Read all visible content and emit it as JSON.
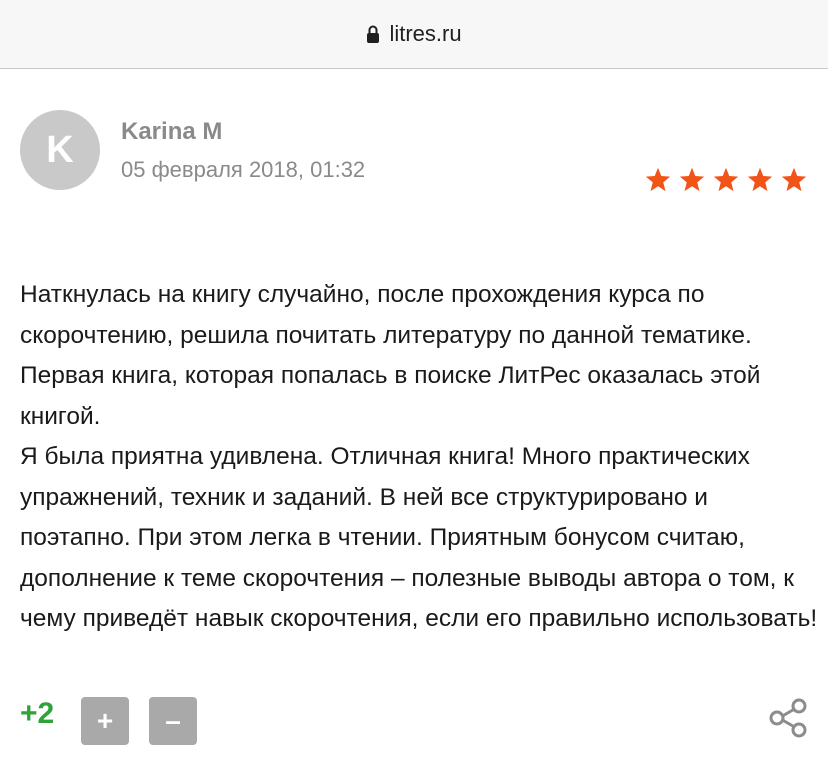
{
  "browser": {
    "url": "litres.ru",
    "icon": "lock-icon"
  },
  "review": {
    "avatar_letter": "K",
    "author": "Karina M",
    "date": "05 февраля 2018, 01:32",
    "rating": 5,
    "rating_max": 5,
    "star_color": "#f25316",
    "paragraphs": [
      "Наткнулась на книгу случайно, после прохождения курса по скорочтению, решила почитать литературу по данной тематике. Первая книга, которая попалась в поиске ЛитРес оказалась этой книгой.",
      "Я была приятна удивлена. Отличная книга! Много практических упражнений, техник и заданий. В ней все структурировано и поэтапно. При этом легка в чтении. Приятным бонусом считаю, дополнение к теме скорочтения – полезные выводы автора о том, к чему приведёт навык скорочтения, если его правильно использовать!"
    ]
  },
  "votes": {
    "score": "+2",
    "score_color": "#2fa339",
    "plus_label": "+",
    "minus_label": "–"
  },
  "actions": {
    "share_icon": "share-icon"
  }
}
